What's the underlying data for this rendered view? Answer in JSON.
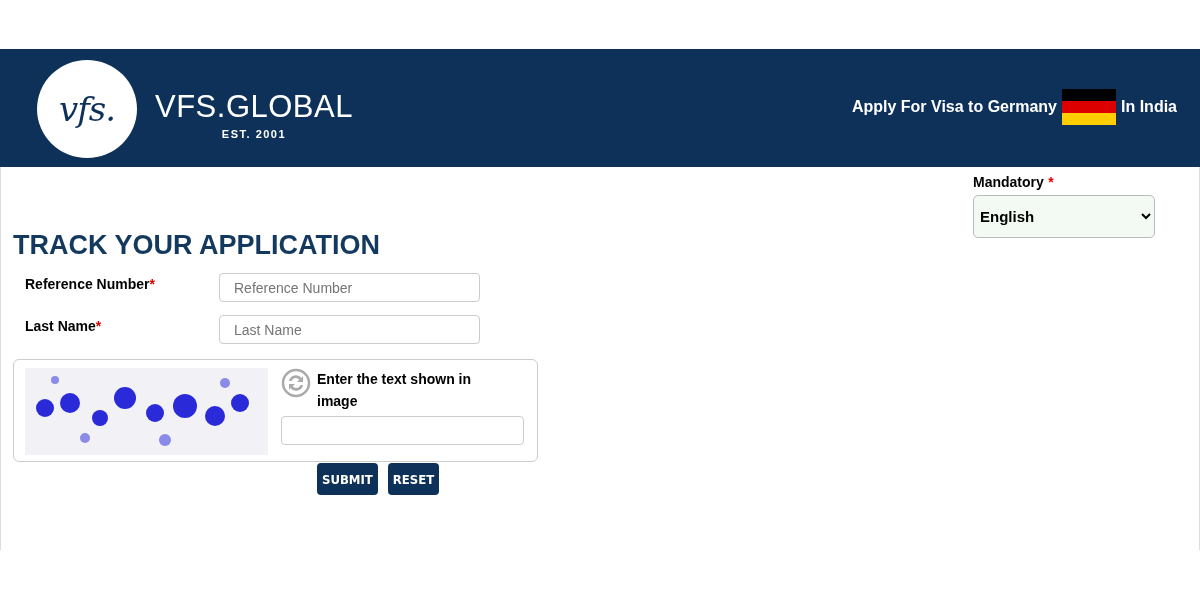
{
  "header": {
    "logo_mark": "vfs.",
    "brand": "VFS.GLOBAL",
    "established": "EST. 2001",
    "tagline_start": "Apply For Visa to Germany",
    "tagline_end": "In India"
  },
  "language": {
    "label": "Mandatory",
    "required_mark": "*",
    "value": "English"
  },
  "title": "TRACK YOUR APPLICATION",
  "fields": [
    {
      "label": "Reference Number",
      "required_mark": "*",
      "placeholder": "Reference Number"
    },
    {
      "label": "Last Name",
      "required_mark": "*",
      "placeholder": "Last Name"
    }
  ],
  "captcha": {
    "kind": "picture",
    "prompt": "Enter the text shown in image"
  },
  "buttons": [
    "SUBMIT",
    "RESET"
  ]
}
